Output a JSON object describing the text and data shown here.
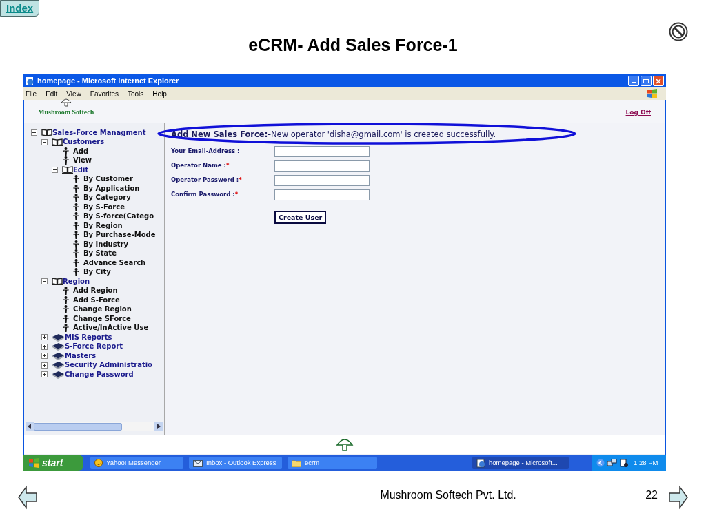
{
  "slide": {
    "index_link": "Index",
    "title": "eCRM- Add Sales Force-1",
    "footer": "Mushroom Softech Pvt. Ltd.",
    "page_number": "22"
  },
  "browser": {
    "title": "homepage - Microsoft Internet Explorer",
    "menu": [
      "File",
      "Edit",
      "View",
      "Favorites",
      "Tools",
      "Help"
    ]
  },
  "header": {
    "logo": "Mushroom Softech",
    "logoff": "Log Off"
  },
  "tree": [
    {
      "label": "Sales-Force Managment",
      "kind": "folder",
      "expanded": true,
      "children": [
        {
          "label": "Customers",
          "kind": "folder",
          "expanded": true,
          "children": [
            {
              "label": "Add",
              "kind": "leaf"
            },
            {
              "label": "View",
              "kind": "leaf"
            },
            {
              "label": "Edit",
              "kind": "folder",
              "expanded": true,
              "children": [
                {
                  "label": "By Customer",
                  "kind": "leaf"
                },
                {
                  "label": "By Application",
                  "kind": "leaf"
                },
                {
                  "label": "By Category",
                  "kind": "leaf"
                },
                {
                  "label": "By S-Force",
                  "kind": "leaf"
                },
                {
                  "label": "By S-force(Catego",
                  "kind": "leaf"
                },
                {
                  "label": "By Region",
                  "kind": "leaf"
                },
                {
                  "label": "By Purchase-Mode",
                  "kind": "leaf"
                },
                {
                  "label": "By Industry",
                  "kind": "leaf"
                },
                {
                  "label": "By State",
                  "kind": "leaf"
                },
                {
                  "label": "Advance Search",
                  "kind": "leaf"
                },
                {
                  "label": "By City",
                  "kind": "leaf"
                }
              ]
            }
          ]
        },
        {
          "label": "Region",
          "kind": "folder",
          "expanded": true,
          "children": [
            {
              "label": "Add Region",
              "kind": "leaf"
            },
            {
              "label": "Add S-Force",
              "kind": "leaf"
            },
            {
              "label": "Change Region",
              "kind": "leaf"
            },
            {
              "label": "Change SForce",
              "kind": "leaf"
            },
            {
              "label": "Active/InActive Use",
              "kind": "leaf"
            }
          ]
        },
        {
          "label": "MIS Reports",
          "kind": "folder",
          "expanded": false
        },
        {
          "label": "S-Force Report",
          "kind": "folder",
          "expanded": false
        },
        {
          "label": "Masters",
          "kind": "folder",
          "expanded": false
        },
        {
          "label": "Security Administratio",
          "kind": "folder",
          "expanded": false
        },
        {
          "label": "Change Password",
          "kind": "folder",
          "expanded": false
        }
      ]
    }
  ],
  "form": {
    "heading": "Add New Sales Force:-",
    "message": "New operator 'disha@gmail.com' is created successfully.",
    "fields": [
      {
        "label": "Your Email-Address :"
      },
      {
        "label": "Operator Name :",
        "required_mark": "*"
      },
      {
        "label": "Operator Password :",
        "required_mark": "*"
      },
      {
        "label": "Confirm Password :",
        "required_mark": "*"
      }
    ],
    "submit": "Create User"
  },
  "taskbar": {
    "start": "start",
    "tasks": [
      {
        "label": "Yahoo! Messenger",
        "kind": "messenger",
        "selected": false
      },
      {
        "label": "Inbox - Outlook Express",
        "kind": "mail",
        "selected": false
      },
      {
        "label": "ecrm",
        "kind": "folder",
        "selected": false
      },
      {
        "label": "homepage - Microsoft...",
        "kind": "browser",
        "selected": true
      }
    ],
    "clock": "1:28 PM"
  }
}
